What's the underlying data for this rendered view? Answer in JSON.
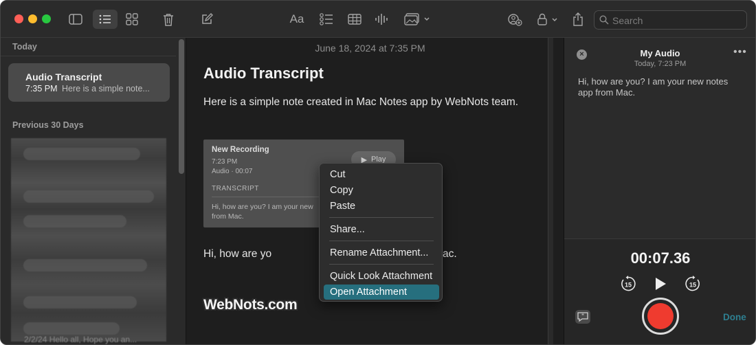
{
  "toolbar": {
    "search_placeholder": "Search",
    "icons": [
      "sidebar-toggle-icon",
      "list-view-icon",
      "gallery-view-icon",
      "trash-icon",
      "compose-icon",
      "text-format-icon",
      "checklist-icon",
      "table-icon",
      "audio-waveform-icon",
      "media-icon",
      "collaborate-icon",
      "lock-icon",
      "share-icon",
      "search-icon"
    ]
  },
  "sidebar": {
    "sections": [
      {
        "title": "Today"
      },
      {
        "title": "Previous 30 Days"
      }
    ],
    "selected_note": {
      "title": "Audio Transcript",
      "time": "7:35 PM",
      "preview": "Here is a simple note..."
    },
    "footer_text": "2/2/24  Hello all, Hope you an..."
  },
  "editor": {
    "date": "June 18, 2024 at 7:35 PM",
    "title": "Audio Transcript",
    "paragraph1": "Here is a simple note created in Mac Notes app by WebNots team.",
    "attachment": {
      "name": "New Recording",
      "time": "7:23 PM",
      "meta": "Audio · 00:07",
      "play_label": "Play",
      "transcript_label": "TRANSCRIPT",
      "transcript_line1": "Hi, how are you? I am your new",
      "transcript_line2": "from Mac."
    },
    "paragraph2_start": "Hi, how are yo",
    "paragraph2_end": "ac.",
    "watermark": "WebNots.com"
  },
  "context_menu": {
    "items": [
      {
        "label": "Cut"
      },
      {
        "label": "Copy"
      },
      {
        "label": "Paste"
      },
      {
        "label": "Share..."
      },
      {
        "label": "Rename Attachment..."
      },
      {
        "label": "Quick Look Attachment"
      },
      {
        "label": "Open Attachment"
      }
    ],
    "active_item": "Open Attachment"
  },
  "audio_panel": {
    "title": "My Audio",
    "subtitle": "Today, 7:23 PM",
    "transcript": "Hi, how are you? I am your new notes app from Mac.",
    "timer": "00:07.36",
    "skip_back": "15",
    "skip_forward": "15",
    "done_label": "Done"
  },
  "colors": {
    "record": "#ef3b2f",
    "menu_highlight": "#266f7e",
    "done_accent": "#2e7f90",
    "close_red": "#ff5f57",
    "minimize_yellow": "#febc2e",
    "zoom_green": "#28c840"
  }
}
